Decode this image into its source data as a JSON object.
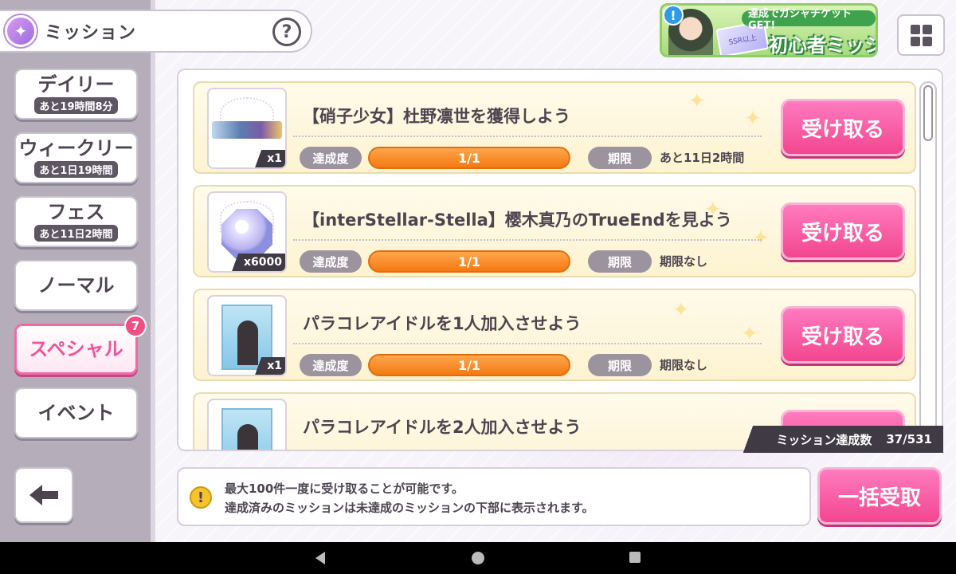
{
  "header": {
    "title": "ミッション",
    "help_label": "?",
    "menu_icon": "grid-menu-icon"
  },
  "banner": {
    "alert": "!",
    "top_text": "達成でガシャチケットGET!",
    "main_text": "初心者ミッション",
    "ticket_text": "SSR以上"
  },
  "tabs": [
    {
      "label": "デイリー",
      "sub": "あと19時間8分"
    },
    {
      "label": "ウィークリー",
      "sub": "あと1日19時間"
    },
    {
      "label": "フェス",
      "sub": "あと11日2時間"
    },
    {
      "label": "ノーマル"
    },
    {
      "label": "スペシャル",
      "badge": "7",
      "active": true
    },
    {
      "label": "イベント"
    }
  ],
  "missions": [
    {
      "title": "【硝子少女】杜野凛世を獲得しよう",
      "qty": "x1",
      "progress_label": "達成度",
      "progress": "1/1",
      "progress_fraction": 1.0,
      "deadline_label": "期限",
      "deadline": "あと11日2時間",
      "claim_label": "受け取る"
    },
    {
      "title": "【interStellar-Stella】樱木真乃のTrueEndを見よう",
      "qty": "x6000",
      "progress_label": "達成度",
      "progress": "1/1",
      "progress_fraction": 1.0,
      "deadline_label": "期限",
      "deadline": "期限なし",
      "claim_label": "受け取る"
    },
    {
      "title": "パラコレアイドルを1人加入させよう",
      "qty": "x1",
      "progress_label": "達成度",
      "progress": "1/1",
      "progress_fraction": 1.0,
      "deadline_label": "期限",
      "deadline": "期限なし",
      "claim_label": "受け取る"
    },
    {
      "title": "パラコレアイドルを2人加入させよう"
    }
  ],
  "mission_count": {
    "label": "ミッション達成数",
    "value": "37/531"
  },
  "notice": {
    "line1": "最大100件一度に受け取ることが可能です。",
    "line2": "達成済みのミッションは未達成のミッションの下部に表示されます。"
  },
  "bulk_claim_label": "一括受取",
  "colors": {
    "accent_pink": "#f2468f",
    "progress_orange": "#f47a12",
    "card_bg": "#fdf3d0"
  }
}
